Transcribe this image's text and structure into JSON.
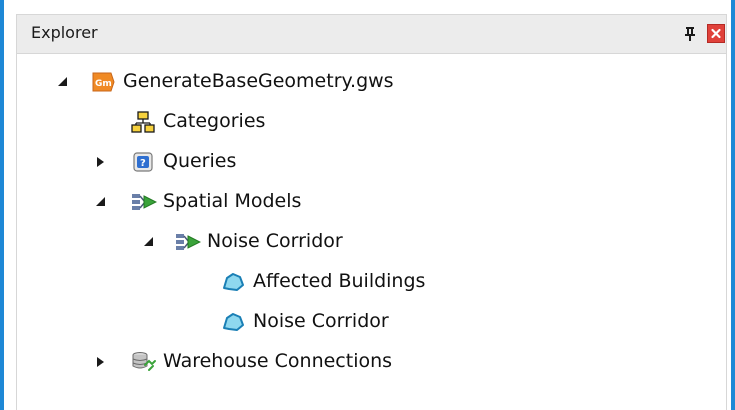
{
  "panel": {
    "title": "Explorer"
  },
  "tree": {
    "root": {
      "label": "GenerateBaseGeometry.gws",
      "icon": "gm-workspace-icon",
      "icon_text": "Gm",
      "expanded": true
    },
    "categories": {
      "label": "Categories",
      "icon": "categories-icon"
    },
    "queries": {
      "label": "Queries",
      "icon": "queries-icon",
      "expanded": false
    },
    "spatial_models": {
      "label": "Spatial Models",
      "icon": "spatial-models-icon",
      "expanded": true
    },
    "noise_corridor_model": {
      "label": "Noise Corridor",
      "icon": "spatial-model-icon",
      "expanded": true
    },
    "affected_buildings": {
      "label": "Affected Buildings",
      "icon": "polygon-layer-icon"
    },
    "noise_corridor_layer": {
      "label": "Noise Corridor",
      "icon": "polygon-layer-icon"
    },
    "warehouse_connections": {
      "label": "Warehouse Connections",
      "icon": "warehouse-connections-icon",
      "expanded": false
    }
  },
  "colors": {
    "frame_border": "#1e88d6",
    "header_bg": "#ececec",
    "close_button": "#e0413a",
    "gm_icon": "#f08a24",
    "polygon_fill": "#8fd8ef",
    "polygon_stroke": "#1a7fb5",
    "arrow_green": "#3aa33a"
  }
}
